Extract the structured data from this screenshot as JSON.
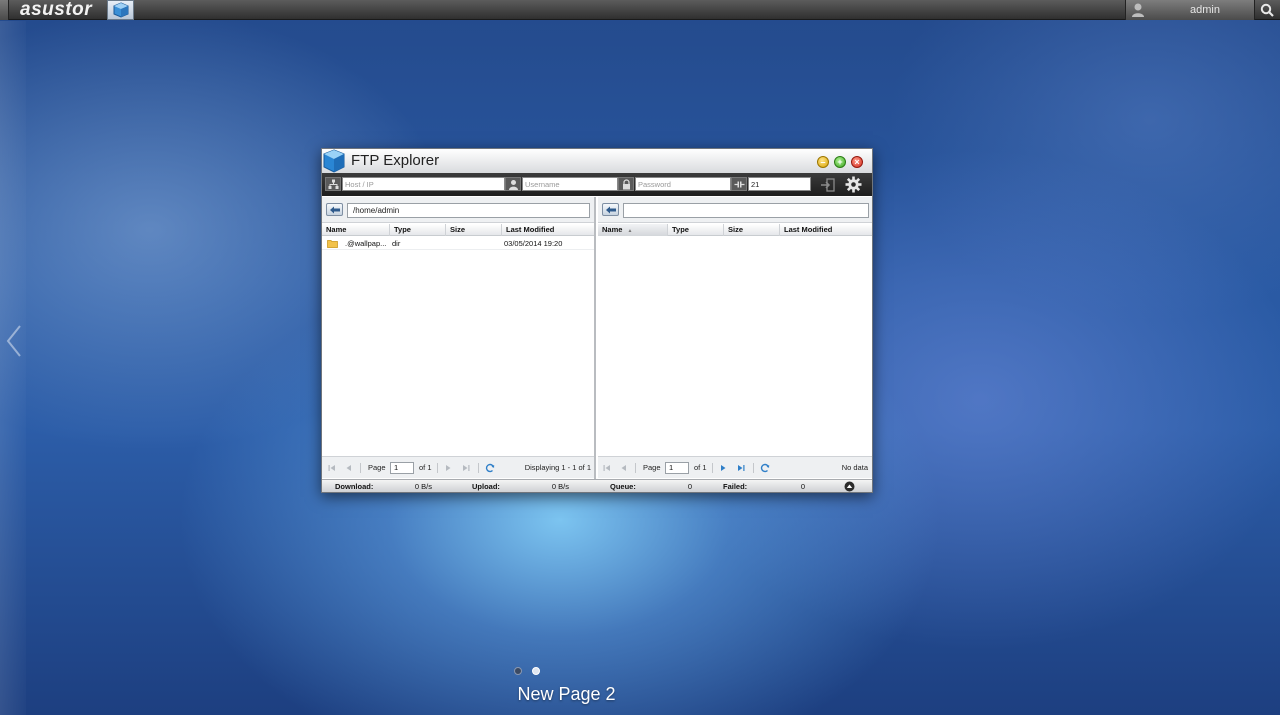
{
  "topbar": {
    "logo": "asustor",
    "user": "admin"
  },
  "desktop": {
    "page_label": "New Page 2"
  },
  "window": {
    "title": "FTP Explorer",
    "connection": {
      "host_placeholder": "Host / IP",
      "username_placeholder": "Username",
      "password_placeholder": "Password",
      "port_value": "21"
    },
    "left_pane": {
      "path": "/home/admin",
      "columns": [
        "Name",
        "Type",
        "Size",
        "Last Modified"
      ],
      "rows": [
        {
          "name": ".@wallpap...",
          "type": "dir",
          "size": "",
          "modified": "03/05/2014 19:20"
        }
      ],
      "pager": {
        "page_label": "Page",
        "page": "1",
        "of_label": "of 1",
        "display": "Displaying 1 - 1 of 1"
      }
    },
    "right_pane": {
      "path": "",
      "columns": [
        "Name",
        "Type",
        "Size",
        "Last Modified"
      ],
      "pager": {
        "page_label": "Page",
        "page": "1",
        "of_label": "of 1",
        "display": "No data"
      }
    },
    "status": {
      "download_label": "Download:",
      "download_value": "0 B/s",
      "upload_label": "Upload:",
      "upload_value": "0 B/s",
      "queue_label": "Queue:",
      "queue_value": "0",
      "failed_label": "Failed:",
      "failed_value": "0"
    }
  },
  "colors": {
    "desktop_blue": "#2a5aa4",
    "connection_bar": "#2a2a2a",
    "window_bg": "#ffffff"
  }
}
